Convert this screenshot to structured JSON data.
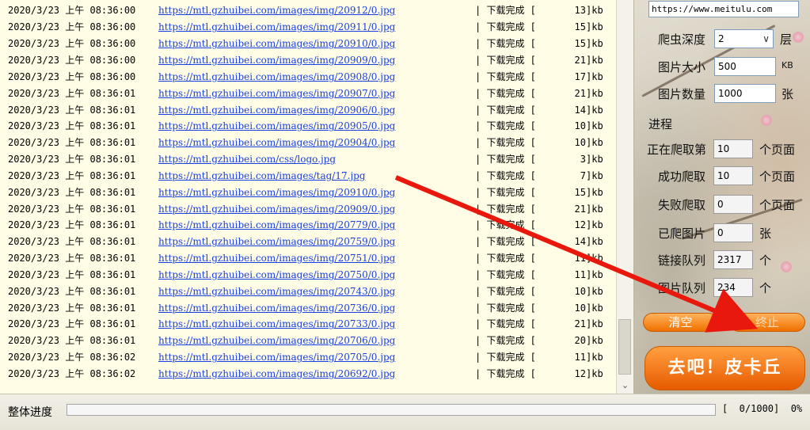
{
  "log": {
    "lines": [
      {
        "ts": "2020/3/23 上午 08:36:00",
        "url": "https://mtl.gzhuibei.com/images/img/20912/0.jpg",
        "status": "| 下载完成 [",
        "size": "13",
        "unit": "]kb"
      },
      {
        "ts": "2020/3/23 上午 08:36:00",
        "url": "https://mtl.gzhuibei.com/images/img/20911/0.jpg",
        "status": "| 下载完成 [",
        "size": "15",
        "unit": "]kb"
      },
      {
        "ts": "2020/3/23 上午 08:36:00",
        "url": "https://mtl.gzhuibei.com/images/img/20910/0.jpg",
        "status": "| 下载完成 [",
        "size": "15",
        "unit": "]kb"
      },
      {
        "ts": "2020/3/23 上午 08:36:00",
        "url": "https://mtl.gzhuibei.com/images/img/20909/0.jpg",
        "status": "| 下载完成 [",
        "size": "21",
        "unit": "]kb"
      },
      {
        "ts": "2020/3/23 上午 08:36:00",
        "url": "https://mtl.gzhuibei.com/images/img/20908/0.jpg",
        "status": "| 下载完成 [",
        "size": "17",
        "unit": "]kb"
      },
      {
        "ts": "2020/3/23 上午 08:36:01",
        "url": "https://mtl.gzhuibei.com/images/img/20907/0.jpg",
        "status": "| 下载完成 [",
        "size": "21",
        "unit": "]kb"
      },
      {
        "ts": "2020/3/23 上午 08:36:01",
        "url": "https://mtl.gzhuibei.com/images/img/20906/0.jpg",
        "status": "| 下载完成 [",
        "size": "14",
        "unit": "]kb"
      },
      {
        "ts": "2020/3/23 上午 08:36:01",
        "url": "https://mtl.gzhuibei.com/images/img/20905/0.jpg",
        "status": "| 下载完成 [",
        "size": "10",
        "unit": "]kb"
      },
      {
        "ts": "2020/3/23 上午 08:36:01",
        "url": "https://mtl.gzhuibei.com/images/img/20904/0.jpg",
        "status": "| 下载完成 [",
        "size": "10",
        "unit": "]kb"
      },
      {
        "ts": "2020/3/23 上午 08:36:01",
        "url": "https://mtl.gzhuibei.com/css/logo.jpg",
        "status": "| 下载完成 [",
        "size": "3",
        "unit": "]kb"
      },
      {
        "ts": "2020/3/23 上午 08:36:01",
        "url": "https://mtl.gzhuibei.com/images/tag/17.jpg",
        "status": "| 下载完成 [",
        "size": "7",
        "unit": "]kb"
      },
      {
        "ts": "2020/3/23 上午 08:36:01",
        "url": "https://mtl.gzhuibei.com/images/img/20910/0.jpg",
        "status": "| 下载完成 [",
        "size": "15",
        "unit": "]kb"
      },
      {
        "ts": "2020/3/23 上午 08:36:01",
        "url": "https://mtl.gzhuibei.com/images/img/20909/0.jpg",
        "status": "| 下载完成 [",
        "size": "21",
        "unit": "]kb"
      },
      {
        "ts": "2020/3/23 上午 08:36:01",
        "url": "https://mtl.gzhuibei.com/images/img/20779/0.jpg",
        "status": "| 下载完成 [",
        "size": "12",
        "unit": "]kb"
      },
      {
        "ts": "2020/3/23 上午 08:36:01",
        "url": "https://mtl.gzhuibei.com/images/img/20759/0.jpg",
        "status": "| 下载完成 [",
        "size": "14",
        "unit": "]kb"
      },
      {
        "ts": "2020/3/23 上午 08:36:01",
        "url": "https://mtl.gzhuibei.com/images/img/20751/0.jpg",
        "status": "| 下载完成 [",
        "size": "11",
        "unit": "]kb"
      },
      {
        "ts": "2020/3/23 上午 08:36:01",
        "url": "https://mtl.gzhuibei.com/images/img/20750/0.jpg",
        "status": "| 下载完成 [",
        "size": "11",
        "unit": "]kb"
      },
      {
        "ts": "2020/3/23 上午 08:36:01",
        "url": "https://mtl.gzhuibei.com/images/img/20743/0.jpg",
        "status": "| 下载完成 [",
        "size": "10",
        "unit": "]kb"
      },
      {
        "ts": "2020/3/23 上午 08:36:01",
        "url": "https://mtl.gzhuibei.com/images/img/20736/0.jpg",
        "status": "| 下载完成 [",
        "size": "10",
        "unit": "]kb"
      },
      {
        "ts": "2020/3/23 上午 08:36:01",
        "url": "https://mtl.gzhuibei.com/images/img/20733/0.jpg",
        "status": "| 下载完成 [",
        "size": "21",
        "unit": "]kb"
      },
      {
        "ts": "2020/3/23 上午 08:36:01",
        "url": "https://mtl.gzhuibei.com/images/img/20706/0.jpg",
        "status": "| 下载完成 [",
        "size": "20",
        "unit": "]kb"
      },
      {
        "ts": "2020/3/23 上午 08:36:02",
        "url": "https://mtl.gzhuibei.com/images/img/20705/0.jpg",
        "status": "| 下载完成 [",
        "size": "11",
        "unit": "]kb"
      },
      {
        "ts": "2020/3/23 上午 08:36:02",
        "url": "https://mtl.gzhuibei.com/images/img/20692/0.jpg",
        "status": "| 下载完成 [",
        "size": "12",
        "unit": "]kb"
      }
    ]
  },
  "panel": {
    "url_value": "https://www.meitulu.com",
    "depth": {
      "label": "爬虫深度",
      "value": "2",
      "unit": "层"
    },
    "img_size": {
      "label": "图片大小",
      "value": "500",
      "unit": "KB"
    },
    "img_count": {
      "label": "图片数量",
      "value": "1000",
      "unit": "张"
    },
    "progress_title": "进程",
    "stats": [
      {
        "label": "正在爬取第",
        "value": "10",
        "unit": "个页面"
      },
      {
        "label": "成功爬取",
        "value": "10",
        "unit": "个页面"
      },
      {
        "label": "失败爬取",
        "value": "0",
        "unit": "个页面"
      },
      {
        "label": "已爬图片",
        "value": "0",
        "unit": "张"
      },
      {
        "label": "链接队列",
        "value": "2317",
        "unit": "个"
      },
      {
        "label": "图片队列",
        "value": "234",
        "unit": "个"
      }
    ],
    "clear_label": "清空",
    "stop_label": "终止",
    "go_label": "去吧！皮卡丘"
  },
  "bottom": {
    "progress_label": "整体进度",
    "progress_text": "[  0/1000]  0%",
    "progress_fraction": 0
  },
  "colors": {
    "link": "#1a3fe0",
    "button_orange": "#f07000",
    "arrow": "#e8180c"
  }
}
